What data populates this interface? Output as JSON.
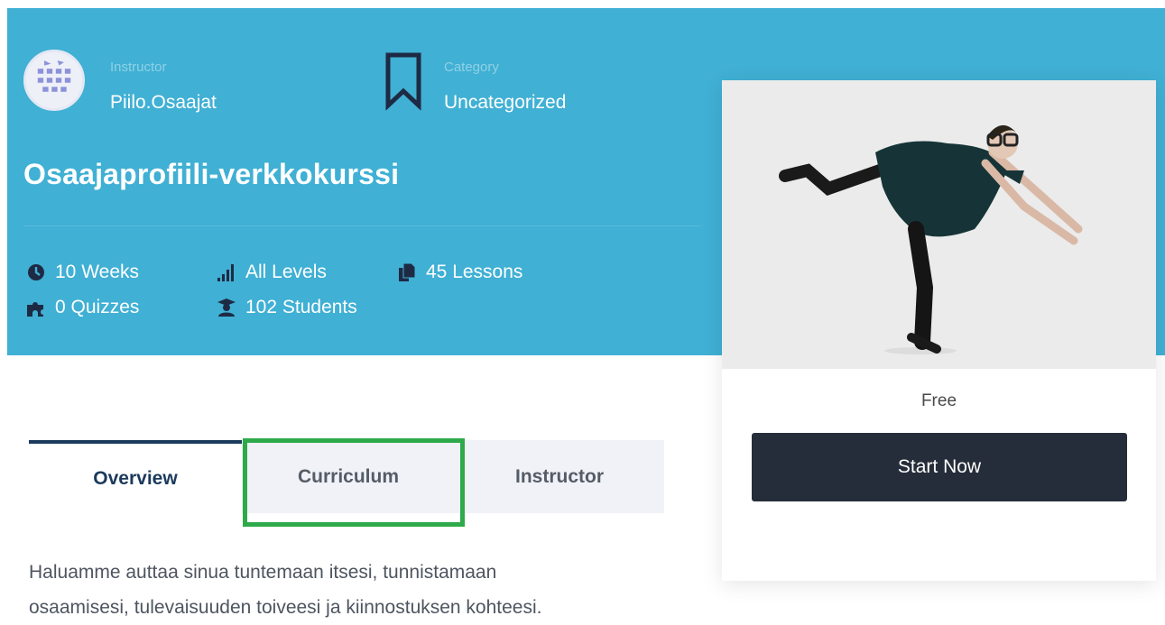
{
  "course": {
    "instructor_label": "Instructor",
    "instructor_name": "Piilo.Osaajat",
    "category_label": "Category",
    "category_value": "Uncategorized",
    "title": "Osaajaprofiili-verkkokurssi"
  },
  "stats": {
    "duration": "10 Weeks",
    "level": "All Levels",
    "lessons": "45 Lessons",
    "quizzes": "0 Quizzes",
    "students": "102 Students"
  },
  "card": {
    "price": "Free",
    "start_label": "Start Now"
  },
  "tabs": [
    {
      "label": "Overview",
      "active": true
    },
    {
      "label": "Curriculum",
      "active": false
    },
    {
      "label": "Instructor",
      "active": false
    }
  ],
  "description": [
    "Haluamme auttaa sinua tuntemaan itsesi, tunnistamaan",
    "osaamisesi, tulevaisuuden toiveesi ja kiinnostuksen kohteesi."
  ],
  "colors": {
    "hero": "#40b0d4",
    "button": "#262d3a",
    "active_tab": "#1b3a5c",
    "highlight": "#2eaa4a"
  },
  "icons": {
    "duration": "clock-icon",
    "level": "signal-bars-icon",
    "lessons": "copy-icon",
    "quizzes": "puzzle-icon",
    "students": "graduate-icon",
    "category": "bookmark-icon"
  }
}
